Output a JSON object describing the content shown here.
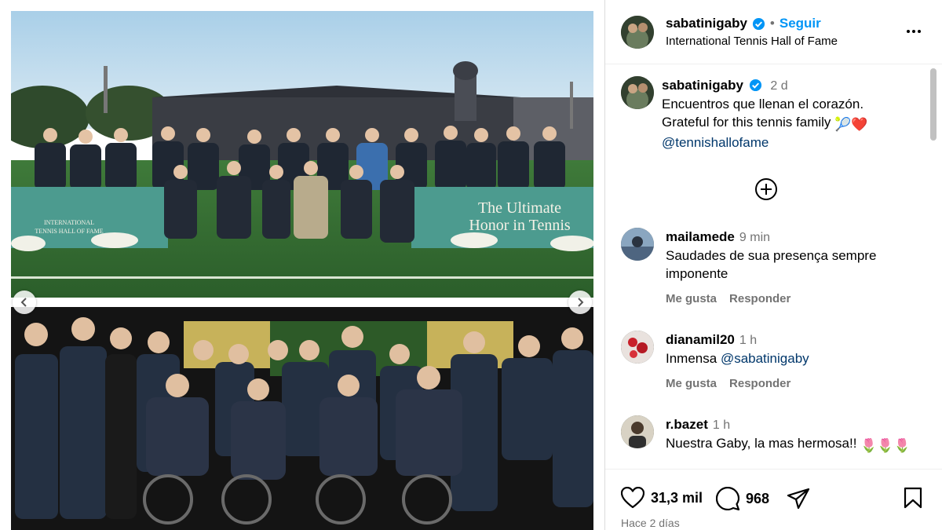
{
  "post": {
    "username": "sabatinigaby",
    "follow_label": "Seguir",
    "separator": "•",
    "location": "International Tennis Hall of Fame",
    "more_icon": "more-horizontal-icon"
  },
  "caption": {
    "username": "sabatinigaby",
    "time": "2 d",
    "line1": "Encuentros que llenan el corazón.",
    "line2": "Grateful for this tennis family",
    "emojis": "🎾❤️",
    "mention": "@tennishallofame"
  },
  "photos": {
    "banner_left_line1": "INTERNATIONAL",
    "banner_left_line2": "TENNIS HALL OF FAME",
    "banner_right_line1": "The Ultimate",
    "banner_right_line2": "Honor in Tennis"
  },
  "comments": [
    {
      "username": "mailamede",
      "time": "9 min",
      "text": "Saudades de sua presença sempre imponente",
      "like_label": "Me gusta",
      "reply_label": "Responder"
    },
    {
      "username": "dianamil20",
      "time": "1 h",
      "text_prefix": "Inmensa",
      "mention": "@sabatinigaby",
      "like_label": "Me gusta",
      "reply_label": "Responder"
    },
    {
      "username": "r.bazet",
      "time": "1 h",
      "text": "Nuestra Gaby, la mas hermosa!!",
      "emojis": "🌷🌷🌷"
    }
  ],
  "actions": {
    "likes": "31,3 mil",
    "comments": "968",
    "posted": "Hace 2 días"
  },
  "colors": {
    "link_blue": "#0095f6",
    "mention_blue": "#00376b",
    "muted": "#737373",
    "banner_teal": "#4c9b8f"
  }
}
